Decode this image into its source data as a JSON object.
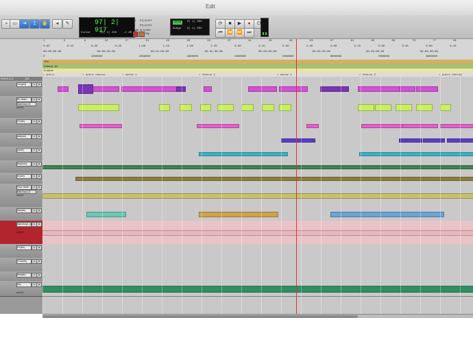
{
  "window": {
    "title": "Edit"
  },
  "toolbar": {
    "counter_main": "97| 2| 917",
    "cursor_label": "Cursor",
    "cursor_value": "52| 4| 218",
    "start_label": "Start",
    "end_label": "End",
    "length_label": "Length",
    "start_value": "97| 2| 917",
    "end_value": "97| 2| 917",
    "length_value": "0| 0| 000",
    "grid_label": "Grid",
    "grid_value": "0| 1| 000",
    "nudge_label": "Nudge",
    "nudge_value": "0| 1| 000",
    "dly_label": "Dly"
  },
  "rulers": {
    "bars_ticks": [
      "1",
      "5",
      "9",
      "13",
      "17",
      "21",
      "25",
      "29",
      "33",
      "37",
      "41",
      "45",
      "49",
      "53",
      "57",
      "61",
      "65",
      "69",
      "73",
      "77",
      "81"
    ],
    "minsecs": [
      "0:00",
      "0:15",
      "0:30",
      "0:45",
      "1:00",
      "1:15",
      "1:30",
      "1:45",
      "2:00",
      "2:15",
      "2:30",
      "2:45",
      "3:00",
      "3:15",
      "3:30",
      "3:45",
      "4:00",
      "4:15"
    ],
    "timecode": [
      "00:00:00:00",
      "00:00:30:00",
      "00:01:00:00",
      "00:01:30:00",
      "00:02:00:00",
      "00:02:30:00",
      "00:03:00:00",
      "00:03:30:00"
    ],
    "samples": [
      "0",
      "1000000",
      "2000000",
      "3000000",
      "4000000",
      "5000000",
      "6000000",
      "7000000",
      "8000000"
    ],
    "tempo": "104",
    "meter": "Default: 4/4",
    "key": "D minor",
    "markers": [
      "intro",
      "intro chorus",
      "verse 1",
      "chorus 1",
      "verse 2",
      "chorus 2",
      "outro chorus"
    ]
  },
  "tracklist": {
    "header": "ENDS A-E",
    "header_count": "118",
    "tracks": [
      {
        "name": "Vox(pth)",
        "io": "",
        "vol": "",
        "color": "#a7a7a7"
      },
      {
        "name": "BV folder",
        "io": "MainOutpt_M",
        "vol": "vol 0.0",
        "color": "#a7a7a7"
      },
      {
        "name": "FX(sth)",
        "io": "",
        "vol": "",
        "color": "#a7a7a7"
      },
      {
        "name": "Add(sth)",
        "io": "",
        "vol": "",
        "color": "#a7a7a7"
      },
      {
        "name": "pl(sth)",
        "io": "",
        "vol": "",
        "color": "#a7a7a7"
      },
      {
        "name": "Bas(Inst)",
        "io": "",
        "vol": "",
        "color": "#a7a7a7"
      },
      {
        "name": "Dr(sth)",
        "io": "",
        "vol": "",
        "color": "#a7a7a7"
      },
      {
        "name": "Keys folder",
        "io": "MainOutpt_M",
        "vol": "vol 0.0",
        "color": "#a7a7a7"
      },
      {
        "name": "Stri(sth)",
        "io": "",
        "vol": "",
        "color": "#a7a7a7"
      },
      {
        "name": "MainOutpt_M",
        "io": "",
        "vol": "vol 0.0",
        "color": "#b2252e"
      },
      {
        "name": "FX(sth)",
        "io": "",
        "vol": "",
        "color": "#a7a7a7"
      },
      {
        "name": "VCA(sth)",
        "io": "",
        "vol": "",
        "color": "#a7a7a7"
      },
      {
        "name": "Ref(sth)",
        "io": "",
        "vol": "",
        "color": "#a7a7a7"
      },
      {
        "name": "Mix",
        "io": "",
        "vol": "vol 0.0",
        "color": "#a7a7a7"
      }
    ]
  },
  "colors": {
    "magenta": "#d54fd6",
    "purple": "#7b34b5",
    "lime": "#c9ef61",
    "pink": "#e45fc9",
    "indigo": "#5b3cc4",
    "cyan": "#3bb0c8",
    "green": "#3d8352",
    "olive": "#8f7c3a",
    "khaki": "#c9c06a",
    "pinklane": "#e9b8bd",
    "cursor": "#e03030"
  }
}
